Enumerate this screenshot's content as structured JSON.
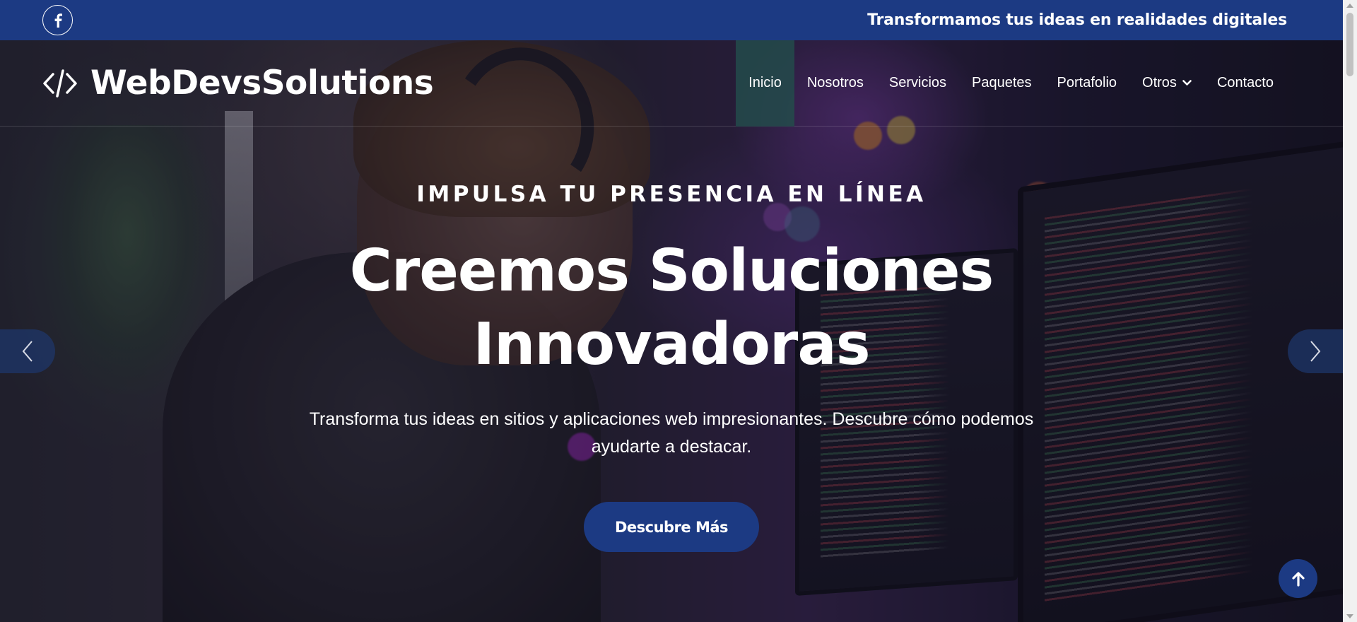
{
  "topbar": {
    "tagline": "Transformamos tus ideas en realidades digitales",
    "social_icon": "facebook-icon"
  },
  "brand": {
    "icon": "code-brackets-icon",
    "name": "WebDevsSolutions"
  },
  "nav": {
    "items": [
      {
        "label": "Inicio",
        "active": true
      },
      {
        "label": "Nosotros"
      },
      {
        "label": "Servicios"
      },
      {
        "label": "Paquetes"
      },
      {
        "label": "Portafolio"
      },
      {
        "label": "Otros",
        "has_dropdown": true
      },
      {
        "label": "Contacto"
      }
    ]
  },
  "hero": {
    "eyebrow": "IMPULSA TU PRESENCIA EN LÍNEA",
    "headline_line1": "Creemos Soluciones",
    "headline_line2": "Innovadoras",
    "subtext": "Transforma tus ideas en sitios y aplicaciones web impresionantes. Descubre cómo podemos ayudarte a destacar.",
    "cta_label": "Descubre Más"
  },
  "carousel": {
    "prev_icon": "chevron-left-icon",
    "next_icon": "chevron-right-icon"
  },
  "back_to_top": {
    "icon": "arrow-up-icon"
  },
  "colors": {
    "primary": "#1c3a83",
    "active_nav": "#234b4b",
    "text": "#ffffff"
  }
}
